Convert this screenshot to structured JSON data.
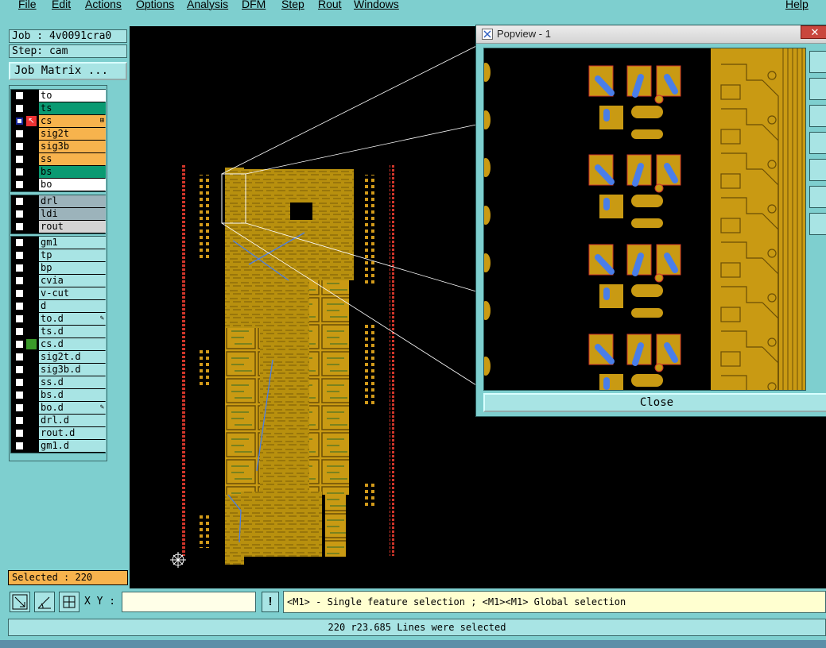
{
  "menu": {
    "file": "File",
    "edit": "Edit",
    "actions": "Actions",
    "options": "Options",
    "analysis": "Analysis",
    "dfm": "DFM",
    "step": "Step",
    "rout": "Rout",
    "windows": "Windows",
    "help": "Help"
  },
  "job": {
    "job_label": "Job : 4v0091cra0",
    "step_label": "Step: cam",
    "matrix_button": "Job Matrix ..."
  },
  "layers": {
    "group1": [
      {
        "name": "to",
        "bg": "#ffffff"
      },
      {
        "name": "ts",
        "bg": "#0a9a72"
      },
      {
        "name": "cs",
        "bg": "#f7b34d",
        "active": true,
        "mark": "⊞"
      },
      {
        "name": "sig2t",
        "bg": "#f7b34d"
      },
      {
        "name": "sig3b",
        "bg": "#f7b34d"
      },
      {
        "name": "ss",
        "bg": "#f7b34d"
      },
      {
        "name": "bs",
        "bg": "#0a9a72"
      },
      {
        "name": "bo",
        "bg": "#ffffff"
      }
    ],
    "group2": [
      {
        "name": "drl",
        "bg": "#9cb3bb"
      },
      {
        "name": "ldi",
        "bg": "#9cb3bb"
      },
      {
        "name": "rout",
        "bg": "#d4d4d4"
      }
    ],
    "group3": [
      {
        "name": "gm1",
        "bg": "#a8e4e4"
      },
      {
        "name": "tp",
        "bg": "#a8e4e4"
      },
      {
        "name": "bp",
        "bg": "#a8e4e4"
      },
      {
        "name": "cvia",
        "bg": "#a8e4e4"
      },
      {
        "name": "v-cut",
        "bg": "#a8e4e4"
      },
      {
        "name": "d",
        "bg": "#a8e4e4"
      },
      {
        "name": "to.d",
        "bg": "#a8e4e4",
        "mark": "✎"
      },
      {
        "name": "ts.d",
        "bg": "#a8e4e4"
      },
      {
        "name": "cs.d",
        "bg": "#a8e4e4",
        "swatch": "#3a9a2a"
      },
      {
        "name": "sig2t.d",
        "bg": "#a8e4e4"
      },
      {
        "name": "sig3b.d",
        "bg": "#a8e4e4"
      },
      {
        "name": "ss.d",
        "bg": "#a8e4e4"
      },
      {
        "name": "bs.d",
        "bg": "#a8e4e4"
      },
      {
        "name": "bo.d",
        "bg": "#a8e4e4",
        "mark": "✎"
      },
      {
        "name": "drl.d",
        "bg": "#a8e4e4"
      },
      {
        "name": "rout.d",
        "bg": "#a8e4e4"
      },
      {
        "name": "gm1.d",
        "bg": "#a8e4e4"
      }
    ]
  },
  "selected": "Selected : 220",
  "popview": {
    "title": "Popview - 1",
    "close_x": "✕",
    "close_button": "Close"
  },
  "toolbar": {
    "xy_label": "X Y :",
    "xy_value": "",
    "warn": "!"
  },
  "prompt": "<M1> - Single feature selection ; <M1><M1> Global selection",
  "status": "220 r23.685 Lines were selected",
  "colors": {
    "copper": "#c99a13",
    "trace_blue": "#4a7ee8",
    "pad_red": "#d0352a",
    "panel_bg": "#7ecfcf"
  },
  "icons": [
    "zoom-fit-icon",
    "measure-icon",
    "grid-snap-icon",
    "warning-icon",
    "crosshair-icon",
    "popview-app-icon"
  ]
}
